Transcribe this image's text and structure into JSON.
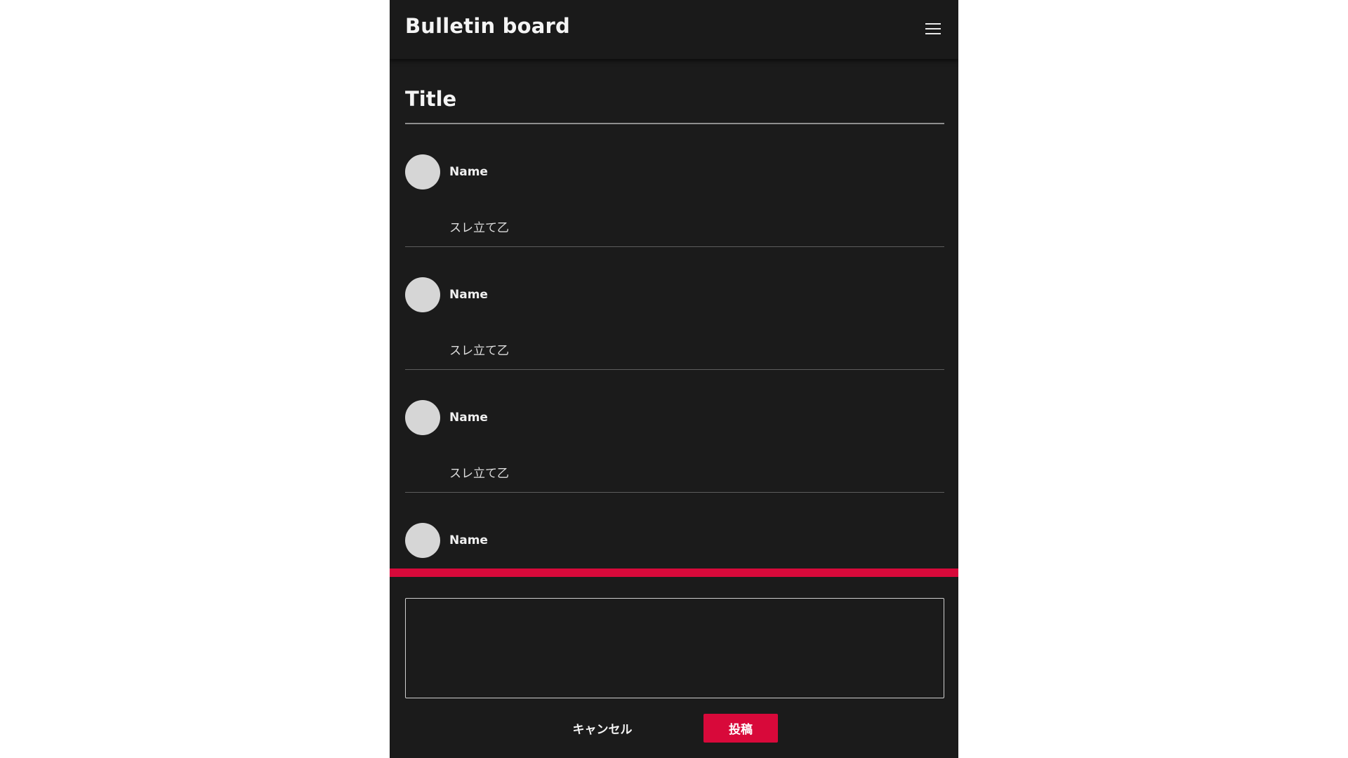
{
  "header": {
    "app_title": "Bulletin board",
    "menu_icon": "hamburger-menu-icon"
  },
  "thread": {
    "title": "Title",
    "posts": [
      {
        "name": "Name",
        "body": "スレ立て乙"
      },
      {
        "name": "Name",
        "body": "スレ立て乙"
      },
      {
        "name": "Name",
        "body": "スレ立て乙"
      },
      {
        "name": "Name",
        "body": ""
      }
    ]
  },
  "composer": {
    "value": "",
    "placeholder": "",
    "cancel_label": "キャンセル",
    "submit_label": "投稿"
  },
  "colors": {
    "background": "#1b1b1b",
    "accent": "#d8093a",
    "avatar": "#d6d6d6"
  }
}
